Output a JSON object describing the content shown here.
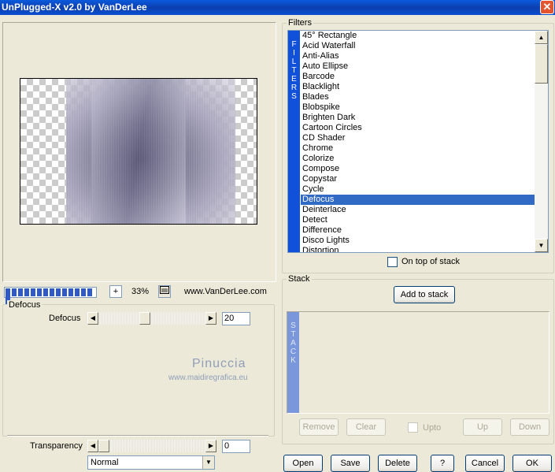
{
  "window": {
    "title": "UnPlugged-X v2.0 by VanDerLee",
    "close_glyph": "✕"
  },
  "filters": {
    "group_label": "Filters",
    "bar_letters": [
      "F",
      "I",
      "L",
      "T",
      "E",
      "R",
      "S"
    ],
    "items": [
      "45° Rectangle",
      "Acid Waterfall",
      "Anti-Alias",
      "Auto Ellipse",
      "Barcode",
      "Blacklight",
      "Blades",
      "Blobspike",
      "Brighten Dark",
      "Cartoon Circles",
      "CD Shader",
      "Chrome",
      "Colorize",
      "Compose",
      "Copystar",
      "Cycle",
      "Defocus",
      "Deinterlace",
      "Detect",
      "Difference",
      "Disco Lights",
      "Distortion"
    ],
    "selected": "Defocus",
    "on_top_label": "On top of stack",
    "on_top_checked": false
  },
  "stack": {
    "group_label": "Stack",
    "add_label": "Add to stack",
    "bar_letters": [
      "S",
      "T",
      "A",
      "C",
      "K"
    ],
    "remove_label": "Remove",
    "clear_label": "Clear",
    "upto_label": "Upto",
    "up_label": "Up",
    "down_label": "Down"
  },
  "zoom": {
    "plus_label": "+",
    "value": "33%",
    "website": "www.VanDerLee.com",
    "progress_blocks": 15
  },
  "params": {
    "group_label": "Defocus",
    "defocus_label": "Defocus",
    "defocus_value": "20",
    "defocus_fraction": 0.43,
    "transparency_label": "Transparency",
    "transparency_value": "0",
    "transparency_fraction": 0.0,
    "blend_mode": "Normal"
  },
  "watermark": {
    "name": "Pinuccia",
    "url": "www.maidiregrafica.eu"
  },
  "buttons": {
    "open": "Open",
    "save": "Save",
    "delete": "Delete",
    "help": "?",
    "cancel": "Cancel",
    "ok": "OK"
  },
  "icons": {
    "up_arrow": "▲",
    "down_arrow": "▼",
    "left_arrow": "◀",
    "right_arrow": "▶"
  },
  "colors": {
    "titlebar": "#0c3fb0",
    "filters_bar": "#1150d8",
    "stack_bar": "#7b97dc",
    "selection": "#316ac5"
  }
}
